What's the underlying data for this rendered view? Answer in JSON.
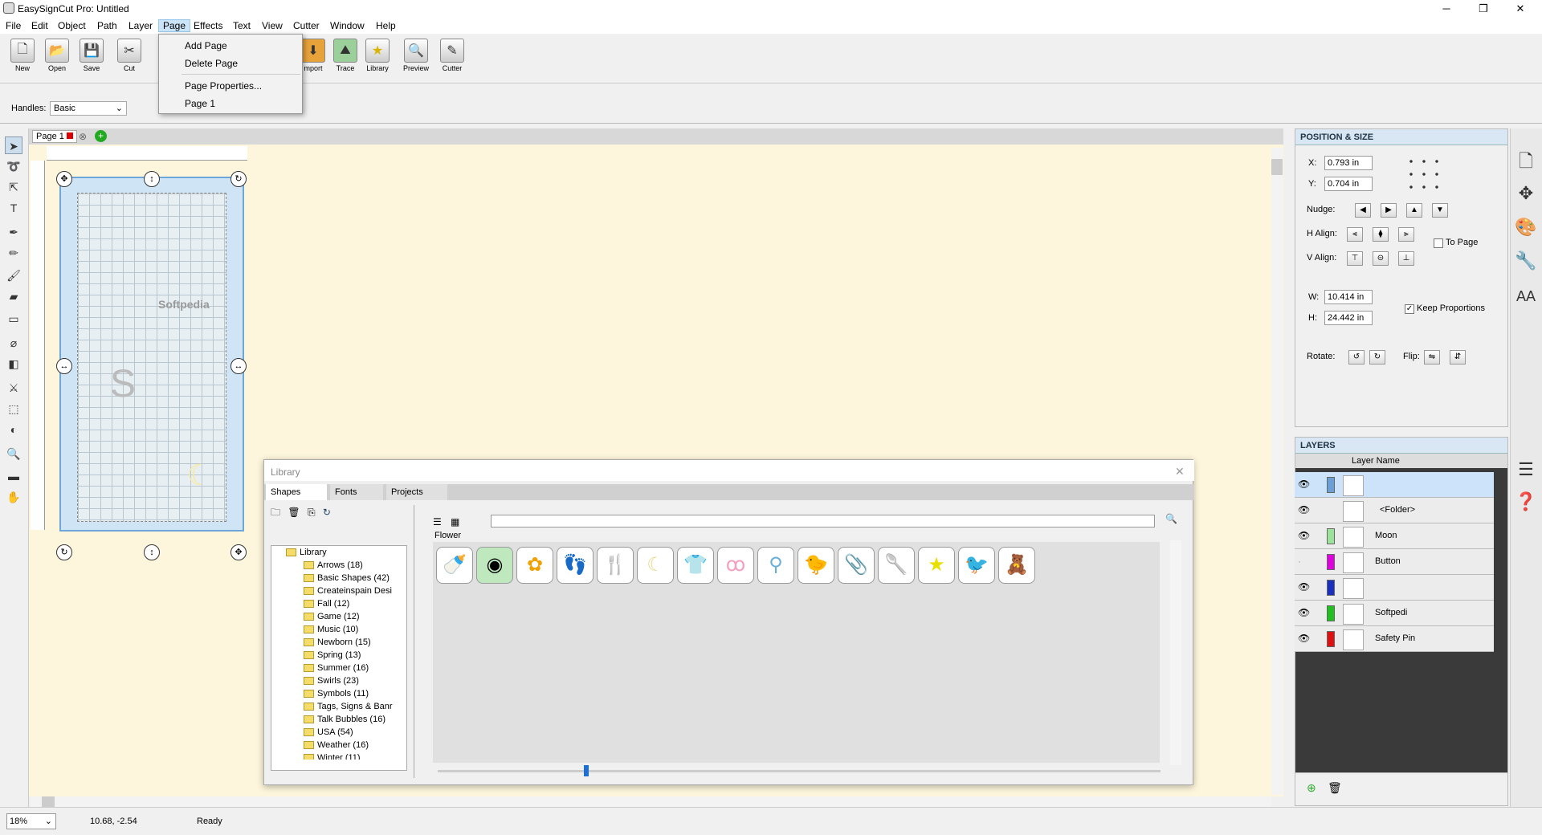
{
  "window": {
    "title": "EasySignCut Pro: Untitled"
  },
  "menubar": {
    "items": [
      "File",
      "Edit",
      "Object",
      "Path",
      "Layer",
      "Page",
      "Effects",
      "Text",
      "View",
      "Cutter",
      "Window",
      "Help"
    ],
    "active": "Page"
  },
  "page_menu": {
    "items": [
      "Add Page",
      "Delete Page",
      "Page Properties...",
      "Page 1"
    ]
  },
  "toolbar": {
    "buttons": [
      {
        "label": "New",
        "icon": "new-icon"
      },
      {
        "label": "Open",
        "icon": "open-icon"
      },
      {
        "label": "Save",
        "icon": "save-icon"
      },
      {
        "label": "Cut",
        "icon": "cut-icon"
      },
      {
        "label": "mport",
        "icon": "import-icon"
      },
      {
        "label": "Trace",
        "icon": "trace-icon"
      },
      {
        "label": "Library",
        "icon": "library-icon"
      },
      {
        "label": "Preview",
        "icon": "preview-icon"
      },
      {
        "label": "Cutter",
        "icon": "cutter-icon"
      }
    ]
  },
  "options": {
    "handles_label": "Handles:",
    "handles_value": "Basic"
  },
  "doc": {
    "tab": "Page 1"
  },
  "position_size": {
    "title": "POSITION & SIZE",
    "x_label": "X:",
    "x": "0.793 in",
    "y_label": "Y:",
    "y": "0.704 in",
    "nudge_label": "Nudge:",
    "halign_label": "H Align:",
    "valign_label": "V Align:",
    "to_page": "To Page",
    "w_label": "W:",
    "w": "10.414 in",
    "h_label": "H:",
    "h": "24.442 in",
    "keep_proportions": "Keep Proportions",
    "rotate_label": "Rotate:",
    "flip_label": "Flip:"
  },
  "layers": {
    "title": "LAYERS",
    "header": "Layer Name",
    "rows": [
      {
        "name": "",
        "color": "#6a9fd8",
        "selected": true
      },
      {
        "name": "<Folder>",
        "color": "",
        "selected": false
      },
      {
        "name": "Moon",
        "color": "#9be29b",
        "selected": false
      },
      {
        "name": "Button",
        "color": "#e000e0",
        "selected": false
      },
      {
        "name": "",
        "color": "#1a2fbf",
        "selected": false
      },
      {
        "name": "Softpedi",
        "color": "#21c021",
        "selected": false
      },
      {
        "name": "Safety Pin",
        "color": "#e01010",
        "selected": false
      }
    ]
  },
  "library": {
    "title": "Library",
    "tabs": [
      "Shapes",
      "Fonts",
      "Projects"
    ],
    "root": "Library",
    "folders": [
      "Arrows (18)",
      "Basic Shapes (42)",
      "Createinspain Desi",
      "Fall (12)",
      "Game (12)",
      "Music (10)",
      "Newborn (15)",
      "Spring (13)",
      "Summer (16)",
      "Swirls (23)",
      "Symbols (11)",
      "Tags, Signs & Banr",
      "Talk Bubbles (16)",
      "USA (54)",
      "Weather (16)",
      "Winter (11)"
    ],
    "category": "Flower",
    "shapes": [
      "bottle-icon",
      "button-icon",
      "flower-icon",
      "footprints-icon",
      "fork-icon",
      "moon-icon",
      "onesie-icon",
      "pacifier-icon",
      "rattle-icon",
      "duck-icon",
      "safety-pin-icon",
      "spoon-icon",
      "star-icon",
      "stork-icon",
      "teddy-bear-icon"
    ]
  },
  "status": {
    "zoom": "18%",
    "coords": "10.68, -2.54",
    "state": "Ready"
  },
  "watermark": "Softpedia"
}
